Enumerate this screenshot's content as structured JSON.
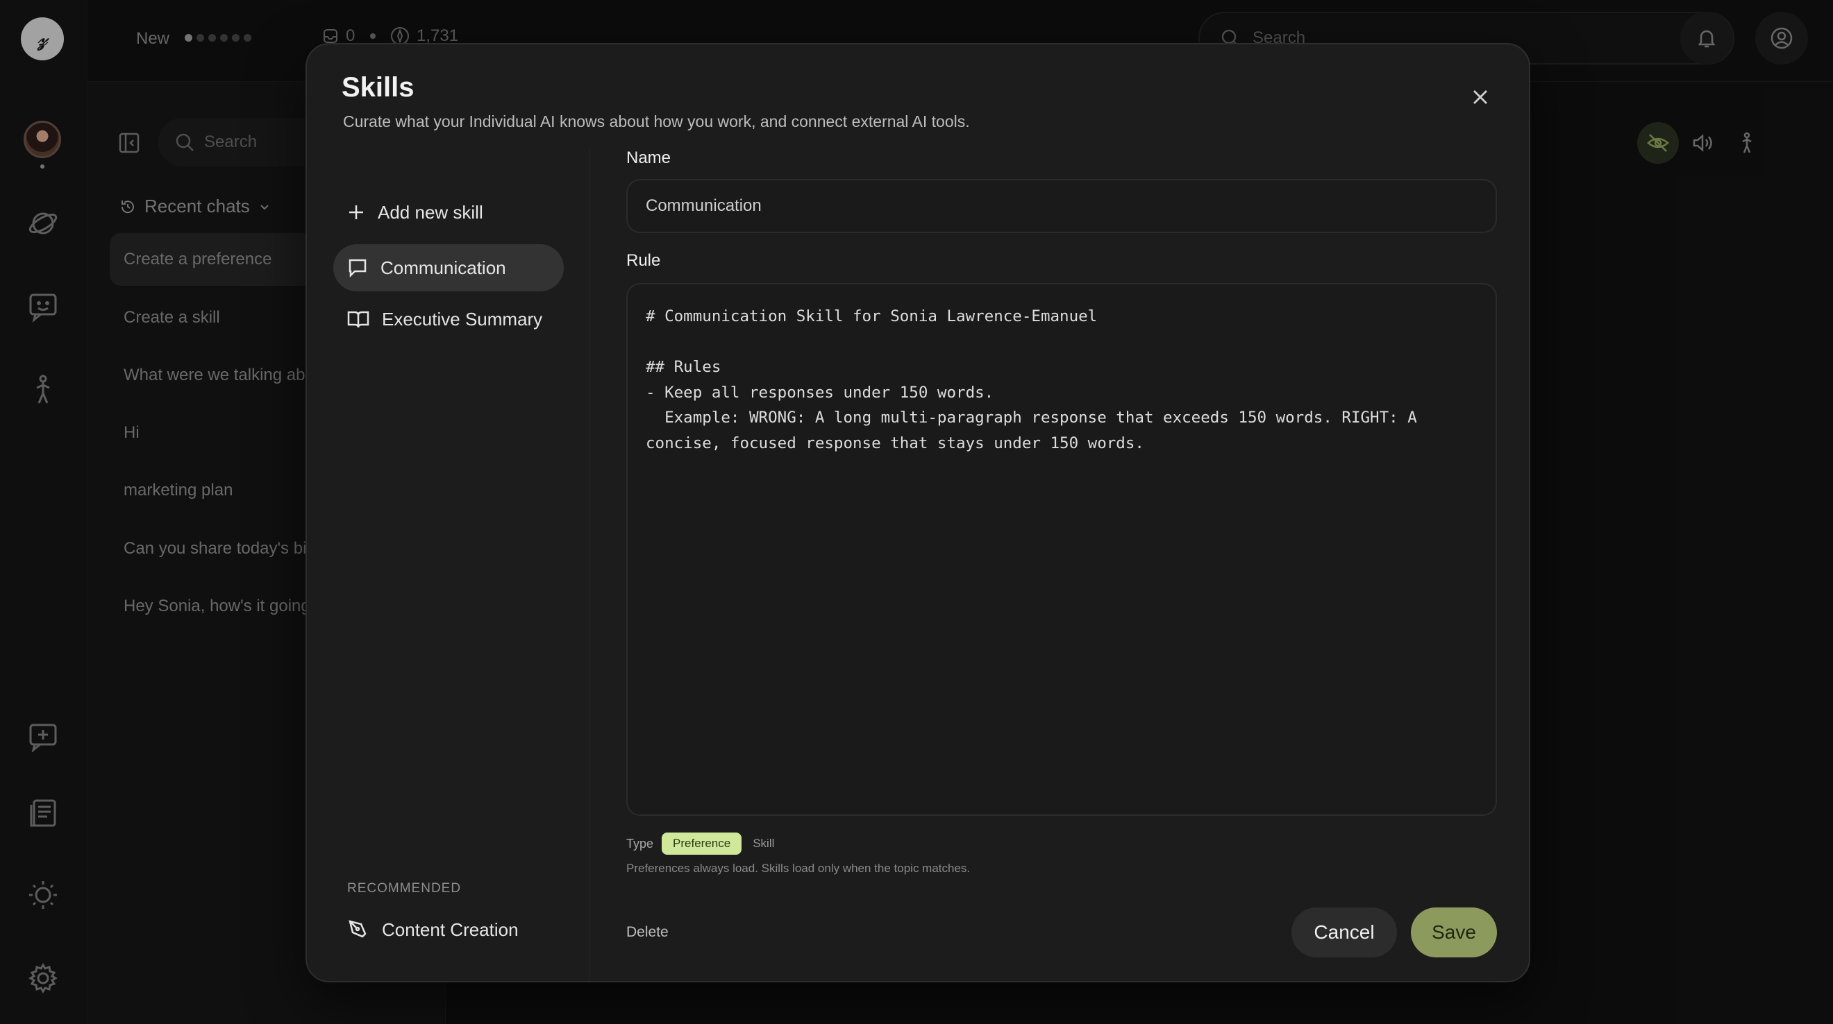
{
  "rail": {
    "logo_text": "𝓏",
    "items": [
      "explore-icon",
      "chat-face-icon",
      "activity-icon"
    ],
    "bottom": [
      "new-chat-icon",
      "notes-icon",
      "sun-icon",
      "gear-icon"
    ]
  },
  "topbar": {
    "new_label": "New",
    "messages_count": "0",
    "points_count": "1,731",
    "search_placeholder": "Search"
  },
  "chats": {
    "search_placeholder": "Search",
    "recent_label": "Recent chats",
    "items": [
      "Create a preference",
      "Create a skill",
      "What were we talking about",
      "Hi",
      "marketing plan",
      "Can you share today's big",
      "Hey Sonia, how's it going"
    ]
  },
  "modal": {
    "title": "Skills",
    "subtitle": "Curate what your Individual AI knows about how you work, and connect external AI tools.",
    "add_label": "Add new skill",
    "skills": [
      "Communication",
      "Executive Summary"
    ],
    "recommended_label": "RECOMMENDED",
    "recommended": [
      "Content Creation"
    ],
    "name_label": "Name",
    "name_value": "Communication",
    "rule_label": "Rule",
    "rule_value": "# Communication Skill for Sonia Lawrence-Emanuel\n\n## Rules\n- Keep all responses under 150 words.\n  Example: WRONG: A long multi-paragraph response that exceeds 150 words. RIGHT: A\nconcise, focused response that stays under 150 words.",
    "type_label": "Type",
    "type_options": [
      "Preference",
      "Skill"
    ],
    "type_hint": "Preferences always load. Skills load only when the topic matches.",
    "delete_label": "Delete",
    "cancel_label": "Cancel",
    "save_label": "Save"
  },
  "colors": {
    "accent": "#cfe89a",
    "save": "#8d9a5d",
    "modal_bg": "#1c1c1c"
  }
}
